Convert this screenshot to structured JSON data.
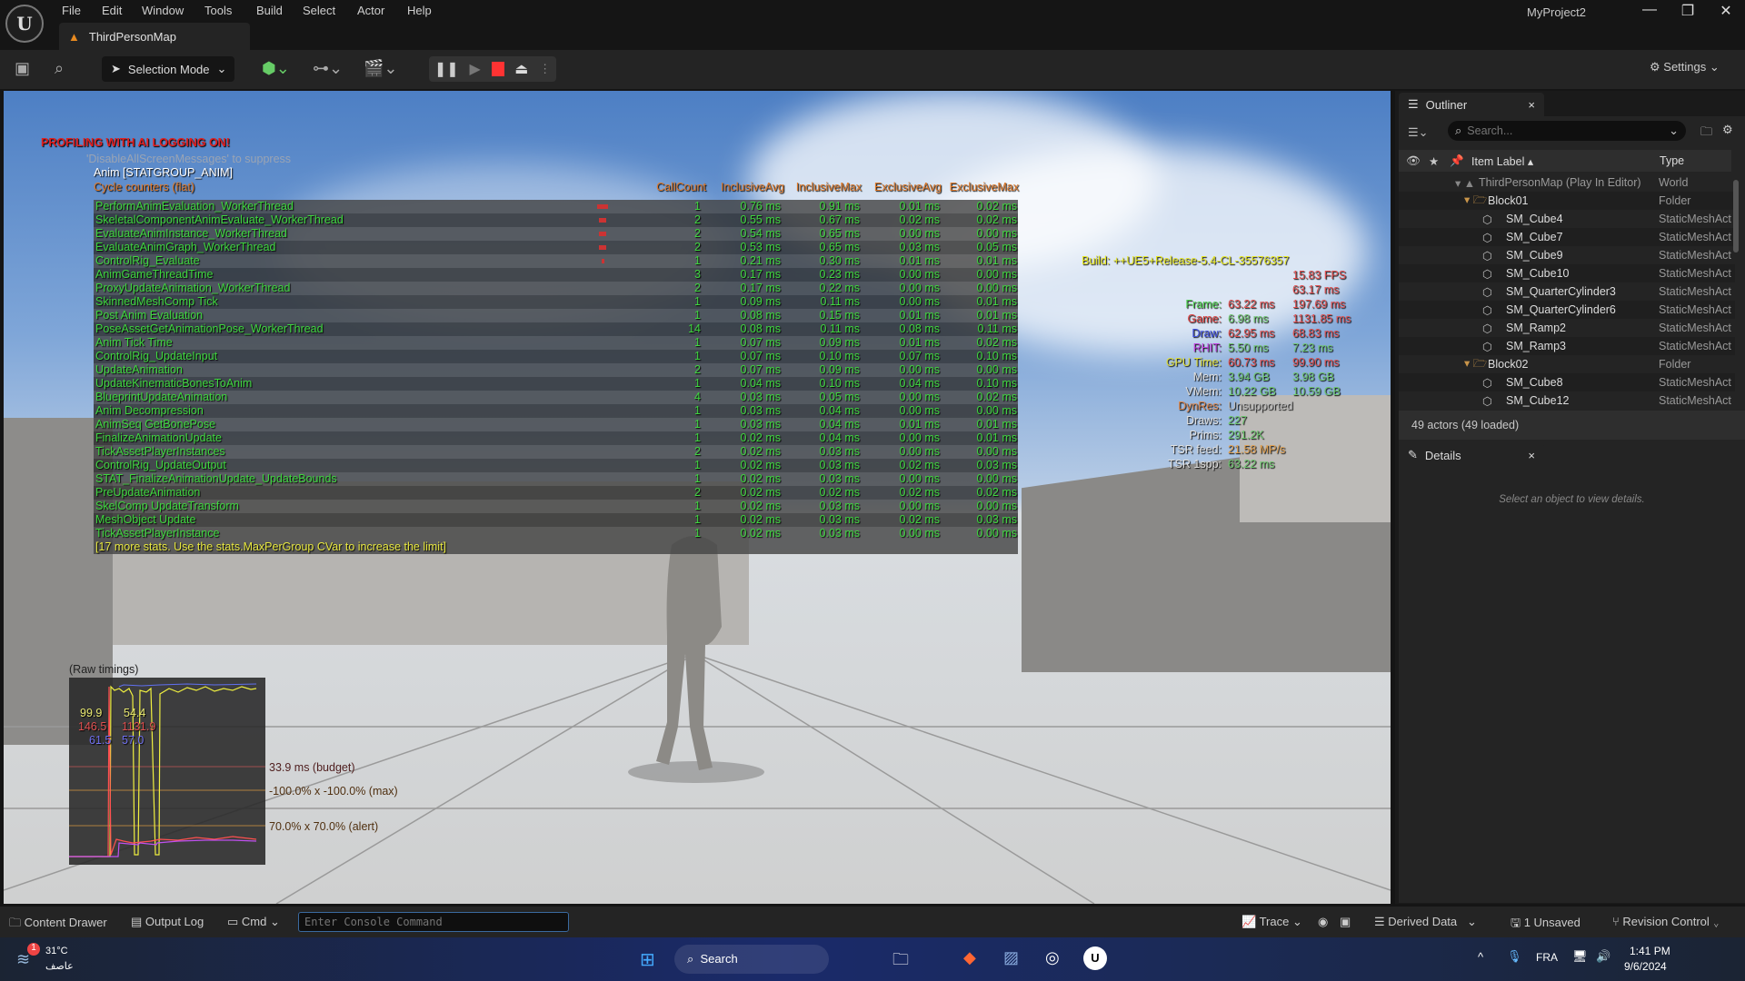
{
  "window": {
    "project": "MyProject2",
    "menu": [
      "File",
      "Edit",
      "Window",
      "Tools",
      "Build",
      "Select",
      "Actor",
      "Help"
    ],
    "map_tab": "ThirdPersonMap"
  },
  "toolbar": {
    "selection_mode": "Selection Mode",
    "settings": "Settings"
  },
  "overlay": {
    "warning": "PROFILING WITH AI LOGGING ON!",
    "suppress": "'DisableAllScreenMessages' to suppress",
    "group": "Anim [STATGROUP_ANIM]",
    "section": "Cycle counters (flat)",
    "columns": [
      "CallCount",
      "InclusiveAvg",
      "InclusiveMax",
      "ExclusiveAvg",
      "ExclusiveMax"
    ],
    "rows": [
      [
        "PerformAnimEvaluation_WorkerThread",
        "1",
        "0.76 ms",
        "0.91 ms",
        "0.01 ms",
        "0.02 ms"
      ],
      [
        "SkeletalComponentAnimEvaluate_WorkerThread",
        "2",
        "0.55 ms",
        "0.67 ms",
        "0.02 ms",
        "0.02 ms"
      ],
      [
        "EvaluateAnimInstance_WorkerThread",
        "2",
        "0.54 ms",
        "0.65 ms",
        "0.00 ms",
        "0.00 ms"
      ],
      [
        "EvaluateAnimGraph_WorkerThread",
        "2",
        "0.53 ms",
        "0.65 ms",
        "0.03 ms",
        "0.05 ms"
      ],
      [
        "ControlRig_Evaluate",
        "1",
        "0.21 ms",
        "0.30 ms",
        "0.01 ms",
        "0.01 ms"
      ],
      [
        "AnimGameThreadTime",
        "3",
        "0.17 ms",
        "0.23 ms",
        "0.00 ms",
        "0.00 ms"
      ],
      [
        "ProxyUpdateAnimation_WorkerThread",
        "2",
        "0.17 ms",
        "0.22 ms",
        "0.00 ms",
        "0.00 ms"
      ],
      [
        "SkinnedMeshComp Tick",
        "1",
        "0.09 ms",
        "0.11 ms",
        "0.00 ms",
        "0.01 ms"
      ],
      [
        "Post Anim Evaluation",
        "1",
        "0.08 ms",
        "0.15 ms",
        "0.01 ms",
        "0.01 ms"
      ],
      [
        "PoseAssetGetAnimationPose_WorkerThread",
        "14",
        "0.08 ms",
        "0.11 ms",
        "0.08 ms",
        "0.11 ms"
      ],
      [
        "Anim Tick Time",
        "1",
        "0.07 ms",
        "0.09 ms",
        "0.01 ms",
        "0.02 ms"
      ],
      [
        "ControlRig_UpdateInput",
        "1",
        "0.07 ms",
        "0.10 ms",
        "0.07 ms",
        "0.10 ms"
      ],
      [
        "UpdateAnimation",
        "2",
        "0.07 ms",
        "0.09 ms",
        "0.00 ms",
        "0.00 ms"
      ],
      [
        "UpdateKinematicBonesToAnim",
        "1",
        "0.04 ms",
        "0.10 ms",
        "0.04 ms",
        "0.10 ms"
      ],
      [
        "BlueprintUpdateAnimation",
        "4",
        "0.03 ms",
        "0.05 ms",
        "0.00 ms",
        "0.02 ms"
      ],
      [
        "Anim Decompression",
        "1",
        "0.03 ms",
        "0.04 ms",
        "0.00 ms",
        "0.00 ms"
      ],
      [
        "AnimSeq GetBonePose",
        "1",
        "0.03 ms",
        "0.04 ms",
        "0.01 ms",
        "0.01 ms"
      ],
      [
        "FinalizeAnimationUpdate",
        "1",
        "0.02 ms",
        "0.04 ms",
        "0.00 ms",
        "0.01 ms"
      ],
      [
        "TickAssetPlayerInstances",
        "2",
        "0.02 ms",
        "0.03 ms",
        "0.00 ms",
        "0.00 ms"
      ],
      [
        "ControlRig_UpdateOutput",
        "1",
        "0.02 ms",
        "0.03 ms",
        "0.02 ms",
        "0.03 ms"
      ],
      [
        "STAT_FinalizeAnimationUpdate_UpdateBounds",
        "1",
        "0.02 ms",
        "0.03 ms",
        "0.00 ms",
        "0.00 ms"
      ],
      [
        "PreUpdateAnimation",
        "2",
        "0.02 ms",
        "0.02 ms",
        "0.02 ms",
        "0.02 ms"
      ],
      [
        "SkelComp UpdateTransform",
        "1",
        "0.02 ms",
        "0.03 ms",
        "0.00 ms",
        "0.00 ms"
      ],
      [
        "MeshObject Update",
        "1",
        "0.02 ms",
        "0.03 ms",
        "0.02 ms",
        "0.03 ms"
      ],
      [
        "TickAssetPlayerInstance",
        "1",
        "0.02 ms",
        "0.03 ms",
        "0.00 ms",
        "0.00 ms"
      ]
    ],
    "more": "[17 more stats. Use the stats.MaxPerGroup CVar to increase the limit]"
  },
  "unit": {
    "build": "Build: ++UE5+Release-5.4-CL-35576357",
    "fps": "15.83 FPS",
    "ms": "63.17 ms",
    "rows": [
      {
        "label": "Frame:",
        "a": "63.22 ms",
        "b": "197.69 ms",
        "lc": "#4fd44f",
        "ac": "#e05050",
        "bc": "#e05050"
      },
      {
        "label": "Game:",
        "a": "6.98 ms",
        "b": "1131.85 ms",
        "lc": "#e04040",
        "ac": "#6fc86f",
        "bc": "#e05050"
      },
      {
        "label": "Draw:",
        "a": "62.95 ms",
        "b": "68.83 ms",
        "lc": "#4050e0",
        "ac": "#e05050",
        "bc": "#e05050"
      },
      {
        "label": "RHIT:",
        "a": "5.50 ms",
        "b": "7.23 ms",
        "lc": "#c040e0",
        "ac": "#6fc86f",
        "bc": "#6fc86f"
      },
      {
        "label": "GPU Time:",
        "a": "60.73 ms",
        "b": "99.90 ms",
        "lc": "#e0e040",
        "ac": "#e05050",
        "bc": "#e05050"
      },
      {
        "label": "Mem:",
        "a": "3.94 GB",
        "b": "3.98 GB",
        "lc": "#e0e0e0",
        "ac": "#6fc86f",
        "bc": "#6fc86f"
      },
      {
        "label": "VMem:",
        "a": "10.22 GB",
        "b": "10.59 GB",
        "lc": "#e0e0e0",
        "ac": "#6fc86f",
        "bc": "#6fc86f"
      },
      {
        "label": "DynRes:",
        "a": "Unsupported",
        "b": "",
        "lc": "#e08a50",
        "ac": "#bbbbbb",
        "bc": ""
      },
      {
        "label": "Draws:",
        "a": "227",
        "b": "",
        "lc": "#e0e0e0",
        "ac": "#6fc86f",
        "bc": ""
      },
      {
        "label": "Prims:",
        "a": "291.2K",
        "b": "",
        "lc": "#e0e0e0",
        "ac": "#6fc86f",
        "bc": ""
      },
      {
        "label": "TSR feed:",
        "a": "21.58 MP/s",
        "b": "",
        "lc": "#e0e0e0",
        "ac": "#e0a050",
        "bc": ""
      },
      {
        "label": "TSR 1spp:",
        "a": "63.22 ms",
        "b": "",
        "lc": "#e0e0e0",
        "ac": "#6fc86f",
        "bc": ""
      }
    ]
  },
  "graph": {
    "title": "(Raw timings)",
    "yellow_a": "99.9",
    "yellow_b": "54.4",
    "red_a": "146.5",
    "red_b": "1131.9",
    "blue_a": "61.5",
    "blue_b": "57.0",
    "budget": "33.9 ms (budget)",
    "max": "-100.0% x -100.0% (max)",
    "alert": "70.0% x 70.0% (alert)"
  },
  "outliner": {
    "tab": "Outliner",
    "search_placeholder": "Search...",
    "col_label": "Item Label",
    "col_type": "Type",
    "items": [
      {
        "label": "ThirdPersonMap (Play In Editor)",
        "type": "World",
        "depth": 0,
        "kind": "world"
      },
      {
        "label": "Block01",
        "type": "Folder",
        "depth": 1,
        "kind": "folder"
      },
      {
        "label": "SM_Cube4",
        "type": "StaticMeshActor",
        "depth": 2,
        "kind": "mesh"
      },
      {
        "label": "SM_Cube7",
        "type": "StaticMeshActor",
        "depth": 2,
        "kind": "mesh"
      },
      {
        "label": "SM_Cube9",
        "type": "StaticMeshActor",
        "depth": 2,
        "kind": "mesh"
      },
      {
        "label": "SM_Cube10",
        "type": "StaticMeshActor",
        "depth": 2,
        "kind": "mesh"
      },
      {
        "label": "SM_QuarterCylinder3",
        "type": "StaticMeshActor",
        "depth": 2,
        "kind": "mesh"
      },
      {
        "label": "SM_QuarterCylinder6",
        "type": "StaticMeshActor",
        "depth": 2,
        "kind": "mesh"
      },
      {
        "label": "SM_Ramp2",
        "type": "StaticMeshActor",
        "depth": 2,
        "kind": "mesh"
      },
      {
        "label": "SM_Ramp3",
        "type": "StaticMeshActor",
        "depth": 2,
        "kind": "mesh"
      },
      {
        "label": "Block02",
        "type": "Folder",
        "depth": 1,
        "kind": "folder"
      },
      {
        "label": "SM_Cube8",
        "type": "StaticMeshActor",
        "depth": 2,
        "kind": "mesh"
      },
      {
        "label": "SM_Cube12",
        "type": "StaticMeshActor",
        "depth": 2,
        "kind": "mesh"
      }
    ],
    "count": "49 actors (49 loaded)"
  },
  "details": {
    "tab": "Details",
    "empty": "Select an object to view details."
  },
  "bottombar": {
    "content_drawer": "Content Drawer",
    "output_log": "Output Log",
    "cmd": "Cmd",
    "console_placeholder": "Enter Console Command",
    "trace": "Trace",
    "derived_data": "Derived Data",
    "unsaved": "1 Unsaved",
    "revision": "Revision Control"
  },
  "taskbar": {
    "temp": "31°C",
    "weather": "عاصف",
    "badge": "1",
    "search": "Search",
    "lang": "FRA",
    "time": "1:41 PM",
    "date": "9/6/2024"
  }
}
